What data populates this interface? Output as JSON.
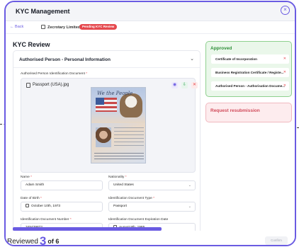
{
  "header": {
    "title": "KYC Management"
  },
  "subbar": {
    "back_label": "Back",
    "company": "Zecrotary Limited",
    "badge": "Pending KYC Review"
  },
  "page": {
    "title": "KYC Review"
  },
  "section": {
    "title": "Authorised Person - Personal Information",
    "doc_label": "Authorised Person Identification Document",
    "file_name": "Passport (USA).jpg",
    "passport_script": "We the People"
  },
  "fields": {
    "name_label": "Name",
    "name_value": "Adam Smith",
    "nationality_label": "Nationality",
    "nationality_value": "United States",
    "dob_label": "Date of Birth",
    "dob_value": "October 10th, 1973",
    "id_type_label": "Identification Document Type",
    "id_type_value": "Passport",
    "id_number_label": "Identification Document Number",
    "id_number_value": "345439872",
    "expiry_label": "Identification Document Expiration Date",
    "expiry_value": "August 8th, 1985"
  },
  "approved": {
    "title": "Approved",
    "items": [
      "Certificate of Incorporation",
      "Business Registration Certificate / Registe...",
      "Authorised Person - Authorisation Docume..."
    ]
  },
  "resubmission": {
    "title": "Request resubmission"
  },
  "footer": {
    "reviewed_label": "Reviewed",
    "reviewed_count": "3",
    "total_label": "of 6",
    "confirm_label": "Confirm"
  },
  "colors": {
    "accent": "#6a5be2",
    "approved": "#2f8f3a",
    "danger": "#e5484d"
  }
}
